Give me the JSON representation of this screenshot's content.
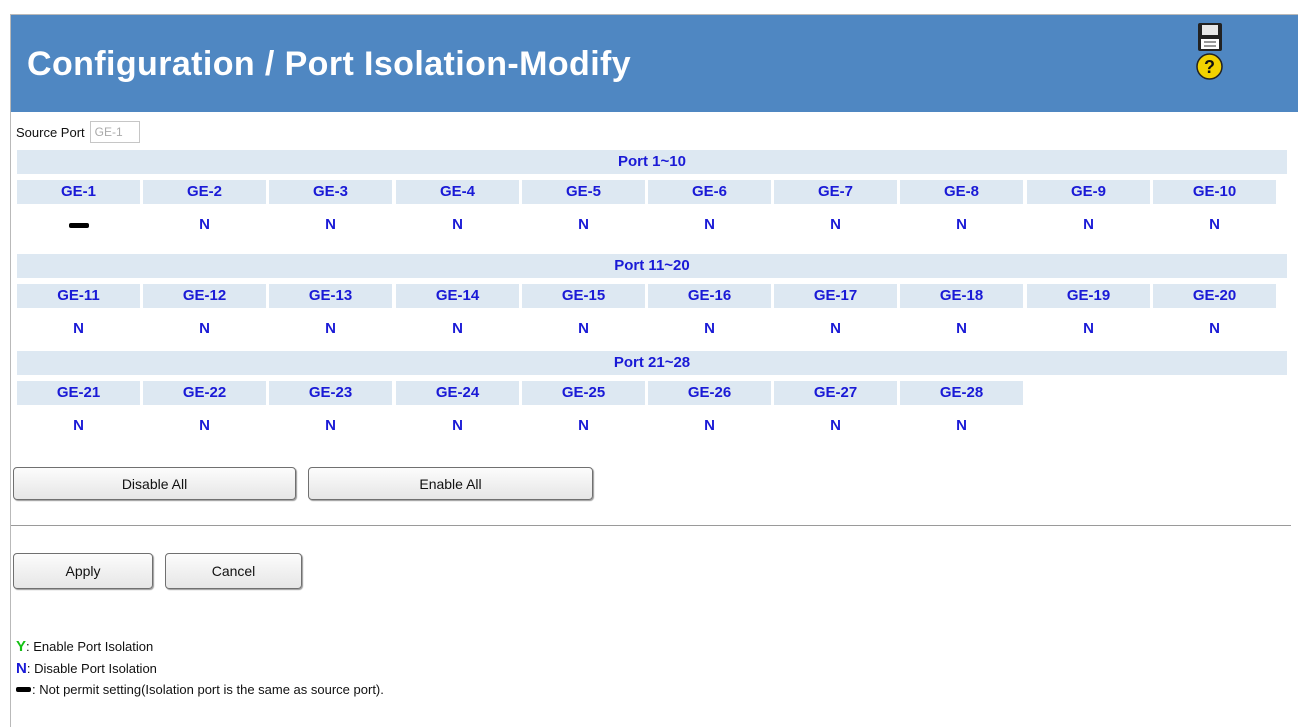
{
  "header": {
    "title": "Configuration / Port Isolation-Modify",
    "accent": "#4f87c2",
    "icons": [
      "save-icon",
      "help-icon"
    ]
  },
  "source_port": {
    "label": "Source Port",
    "value": "GE-1"
  },
  "groups": [
    {
      "title": "Port 1~10",
      "ports": [
        {
          "name": "GE-1",
          "state": "-"
        },
        {
          "name": "GE-2",
          "state": "N"
        },
        {
          "name": "GE-3",
          "state": "N"
        },
        {
          "name": "GE-4",
          "state": "N"
        },
        {
          "name": "GE-5",
          "state": "N"
        },
        {
          "name": "GE-6",
          "state": "N"
        },
        {
          "name": "GE-7",
          "state": "N"
        },
        {
          "name": "GE-8",
          "state": "N"
        },
        {
          "name": "GE-9",
          "state": "N"
        },
        {
          "name": "GE-10",
          "state": "N"
        }
      ]
    },
    {
      "title": "Port 11~20",
      "ports": [
        {
          "name": "GE-11",
          "state": "N"
        },
        {
          "name": "GE-12",
          "state": "N"
        },
        {
          "name": "GE-13",
          "state": "N"
        },
        {
          "name": "GE-14",
          "state": "N"
        },
        {
          "name": "GE-15",
          "state": "N"
        },
        {
          "name": "GE-16",
          "state": "N"
        },
        {
          "name": "GE-17",
          "state": "N"
        },
        {
          "name": "GE-18",
          "state": "N"
        },
        {
          "name": "GE-19",
          "state": "N"
        },
        {
          "name": "GE-20",
          "state": "N"
        }
      ]
    },
    {
      "title": "Port 21~28",
      "ports": [
        {
          "name": "GE-21",
          "state": "N"
        },
        {
          "name": "GE-22",
          "state": "N"
        },
        {
          "name": "GE-23",
          "state": "N"
        },
        {
          "name": "GE-24",
          "state": "N"
        },
        {
          "name": "GE-25",
          "state": "N"
        },
        {
          "name": "GE-26",
          "state": "N"
        },
        {
          "name": "GE-27",
          "state": "N"
        },
        {
          "name": "GE-28",
          "state": "N"
        }
      ]
    }
  ],
  "buttons": {
    "disable_all": "Disable All",
    "enable_all": "Enable All",
    "apply": "Apply",
    "cancel": "Cancel"
  },
  "legend": {
    "y_symbol": "Y",
    "y_text": ": Enable Port Isolation",
    "n_symbol": "N",
    "n_text": ": Disable Port Isolation",
    "dash_text": ": Not permit setting(Isolation port is the same as source port)."
  },
  "colors": {
    "band": "#dde8f2",
    "port_text": "#1a1ad6",
    "enable": "#13c213"
  }
}
